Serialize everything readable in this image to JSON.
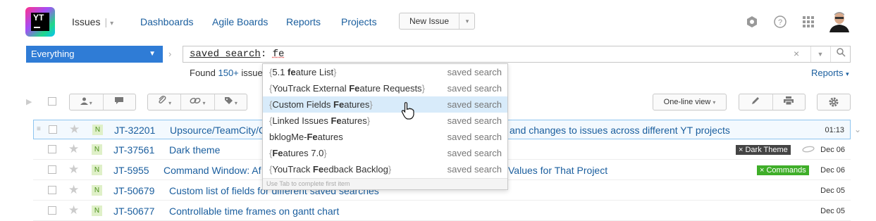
{
  "header": {
    "logo_text": "YT",
    "issues_label": "Issues",
    "nav": [
      {
        "label": "Dashboards"
      },
      {
        "label": "Agile Boards"
      },
      {
        "label": "Reports"
      },
      {
        "label": "Projects"
      }
    ],
    "new_issue_label": "New Issue",
    "icons": [
      "settings-icon",
      "help-icon",
      "apps-grid-icon"
    ]
  },
  "search": {
    "context_label": "Everything",
    "query_key": "saved search",
    "query_sep": ": ",
    "query_value": "fe",
    "clear_icon": "×"
  },
  "results": {
    "found_prefix": "Found ",
    "found_count": "150+",
    "found_suffix": " issue",
    "reports_label": "Reports"
  },
  "toolbar": {
    "view_mode": "One-line view"
  },
  "suggestions": {
    "items": [
      {
        "before": "5.1 ",
        "match": "fe",
        "after": "ature List",
        "type": "saved search",
        "bracketed": true
      },
      {
        "before": "YouTrack External ",
        "match": "Fe",
        "after": "ature Requests",
        "type": "saved search",
        "bracketed": true
      },
      {
        "before": "Custom Fields ",
        "match": "Fe",
        "after": "atures",
        "type": "saved search",
        "bracketed": true,
        "highlighted": true
      },
      {
        "before": "Linked Issues ",
        "match": "Fe",
        "after": "atures",
        "type": "saved search",
        "bracketed": true
      },
      {
        "before": "bklogMe-",
        "match": "Fe",
        "after": "atures",
        "type": "saved search",
        "bracketed": false
      },
      {
        "before": "",
        "match": "Fe",
        "after": "atures 7.0",
        "type": "saved search",
        "bracketed": true
      },
      {
        "before": "YouTrack ",
        "match": "Fe",
        "after": "edback Backlog",
        "type": "saved search",
        "bracketed": true
      }
    ],
    "hint": "Use Tab to complete first item"
  },
  "issues": [
    {
      "priority": "N",
      "id": "JT-32201",
      "summary": "Upsource/TeamCity/C",
      "summary_tail": "and changes to issues across different YT projects",
      "date": "01:13",
      "tag": ""
    },
    {
      "priority": "N",
      "id": "JT-37561",
      "summary": "Dark theme",
      "summary_tail": "",
      "date": "Dec 06",
      "tag": "× Dark Theme"
    },
    {
      "priority": "N",
      "id": "JT-5955",
      "summary": "Command Window: Af",
      "summary_tail": "Values for That Project",
      "date": "Dec 06",
      "tag": "× Commands"
    },
    {
      "priority": "N",
      "id": "JT-50679",
      "summary": "Custom list of fields for different saved searches",
      "summary_tail": "",
      "date": "Dec 05",
      "tag": ""
    },
    {
      "priority": "N",
      "id": "JT-50677",
      "summary": "Controllable time frames on gantt chart",
      "summary_tail": "",
      "date": "Dec 05",
      "tag": ""
    }
  ],
  "colors": {
    "accent": "#2f7cd6",
    "link": "#1a5e9e",
    "tag_dark": "#444444",
    "tag_green": "#3fae29"
  }
}
